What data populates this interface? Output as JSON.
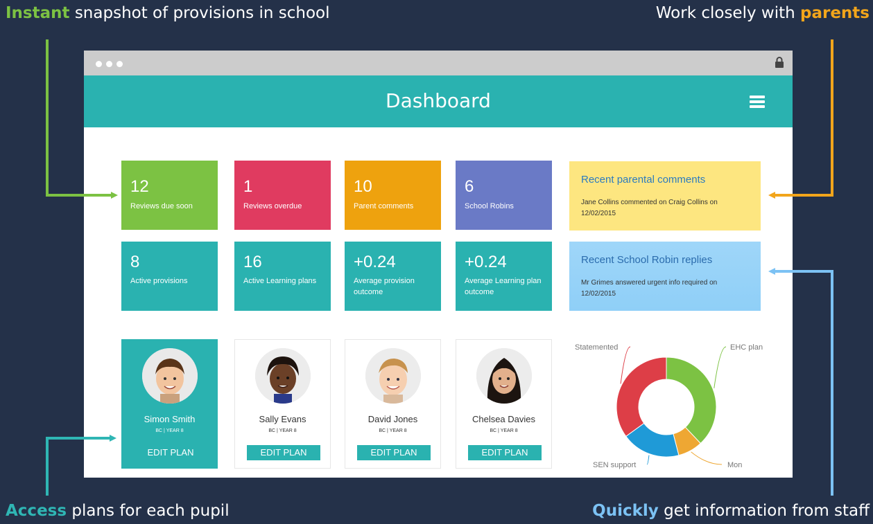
{
  "callouts": {
    "top_left": {
      "highlight": "Instant",
      "rest": " snapshot of provisions in school"
    },
    "top_right": {
      "rest": "Work closely with ",
      "highlight": "parents"
    },
    "bottom_left": {
      "highlight": "Access",
      "rest": " plans for each pupil"
    },
    "bottom_right": {
      "highlight": "Quickly",
      "rest": " get information from staff"
    }
  },
  "header": {
    "title": "Dashboard"
  },
  "tiles": [
    {
      "value": "12",
      "label": "Reviews due soon",
      "color": "#7cc243"
    },
    {
      "value": "1",
      "label": "Reviews overdue",
      "color": "#e03b60"
    },
    {
      "value": "10",
      "label": "Parent comments",
      "color": "#eea20e"
    },
    {
      "value": "6",
      "label": "School Robins",
      "color": "#6a7ac6"
    },
    {
      "value": "8",
      "label": "Active provisions",
      "color": "#2ab2b0"
    },
    {
      "value": "16",
      "label": "Active Learning plans",
      "color": "#2ab2b0"
    },
    {
      "value": "+0.24",
      "label": "Average provision outcome",
      "color": "#2ab2b0"
    },
    {
      "value": "+0.24",
      "label": "Average Learning plan outcome",
      "color": "#2ab2b0"
    }
  ],
  "parental_comments": {
    "heading": "Recent parental comments",
    "text": "Jane Collins commented on Craig Collins on 12/02/2015",
    "color": "#fde680"
  },
  "robin_replies": {
    "heading": "Recent School Robin replies",
    "text": "Mr Grimes answered urgent info required on 12/02/2015",
    "color": "#8fcff7"
  },
  "pupils": [
    {
      "name": "Simon Smith",
      "class": "BC | YEAR 8",
      "button": "EDIT PLAN"
    },
    {
      "name": "Sally Evans",
      "class": "BC | YEAR 8",
      "button": "EDIT PLAN"
    },
    {
      "name": "David Jones",
      "class": "BC | YEAR 8",
      "button": "EDIT PLAN"
    },
    {
      "name": "Chelsea Davies",
      "class": "BC | YEAR 8",
      "button": "EDIT PLAN"
    }
  ],
  "chart_data": {
    "type": "pie",
    "categories": [
      "EHC plan",
      "Mon",
      "SEN support",
      "Statemented"
    ],
    "values": [
      38,
      8,
      19,
      35
    ],
    "colors": [
      "#7cc243",
      "#eea733",
      "#1f9ad7",
      "#dd3e47"
    ]
  }
}
